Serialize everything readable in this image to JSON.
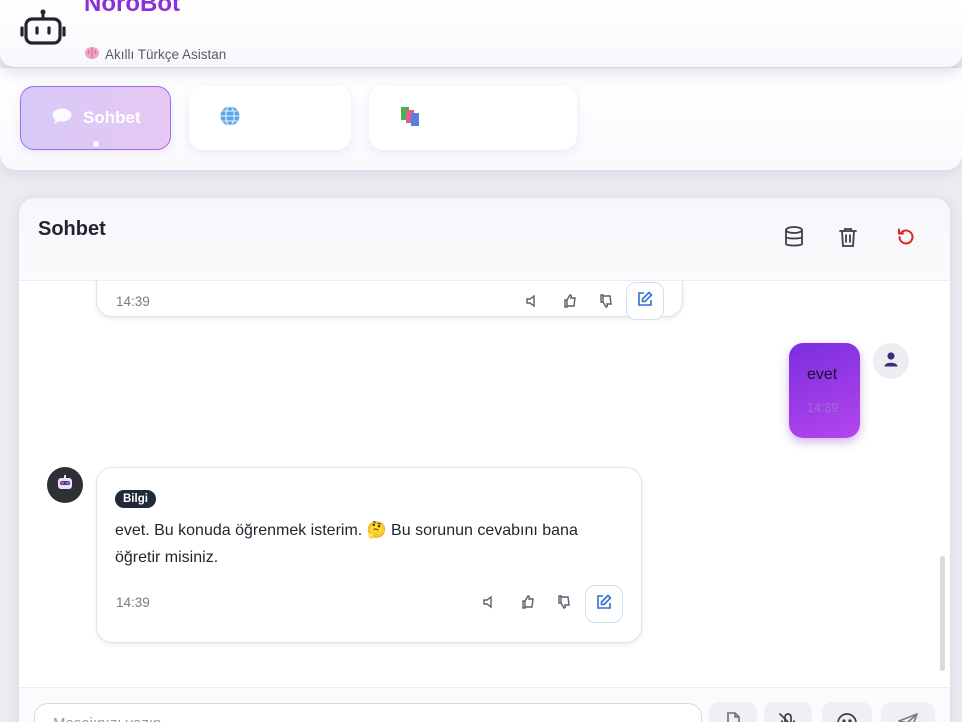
{
  "app": {
    "name": "NöroBot",
    "subtitle": "Akıllı Türkçe Asistan",
    "accent": "#8b2fd8"
  },
  "tabs": [
    {
      "label": "Sohbet",
      "icon": "speech-bubble-icon",
      "active": true
    },
    {
      "label": "",
      "icon": "globe-icon",
      "active": false
    },
    {
      "label": "",
      "icon": "books-icon",
      "active": false
    }
  ],
  "chat": {
    "title": "Sohbet",
    "header_icons": [
      "database-icon",
      "trash-icon",
      "refresh-icon"
    ],
    "messages": [
      {
        "role": "bot",
        "time": "14:39",
        "partial": true
      },
      {
        "role": "user",
        "text": "evet",
        "time": "14:39"
      },
      {
        "role": "bot",
        "badge": "Bilgi",
        "text": "evet. Bu konuda öğrenmek isterim. 🤔 Bu sorunun cevabını bana öğretir misiniz.",
        "time": "14:39"
      }
    ]
  },
  "composer": {
    "placeholder": "Mesajınızı yazın..."
  }
}
